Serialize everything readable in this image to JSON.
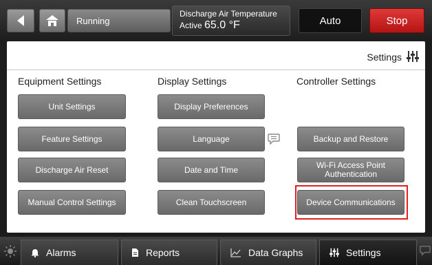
{
  "header": {
    "status": "Running",
    "reading_label": "Discharge Air Temperature",
    "reading_prefix": "Active",
    "reading_value": "65.0 °F",
    "mode_button": "Auto",
    "stop_button": "Stop"
  },
  "panel": {
    "title": "Settings",
    "columns": [
      {
        "heading": "Equipment Settings",
        "buttons": [
          "Unit Settings",
          "Feature Settings",
          "Discharge Air Reset",
          "Manual Control Settings"
        ]
      },
      {
        "heading": "Display Settings",
        "buttons": [
          "Display Preferences",
          "Language",
          "Date and Time",
          "Clean Touchscreen"
        ]
      },
      {
        "heading": "Controller Settings",
        "buttons": [
          "Backup and Restore",
          "Wi-Fi Access Point Authentication",
          "Device Communications"
        ]
      }
    ],
    "highlighted_button": "Device Communications",
    "highlight_color": "#e01f1f"
  },
  "tabs": [
    {
      "label": "Alarms",
      "icon": "bell-icon"
    },
    {
      "label": "Reports",
      "icon": "document-icon"
    },
    {
      "label": "Data Graphs",
      "icon": "line-graph-icon"
    },
    {
      "label": "Settings",
      "icon": "sliders-icon",
      "active": true
    }
  ],
  "colors": {
    "stop_red": "#c81e1e",
    "button_gray": "#7a7a7a",
    "panel_bg": "#ffffff",
    "chrome_dark": "#1c1c1c"
  }
}
